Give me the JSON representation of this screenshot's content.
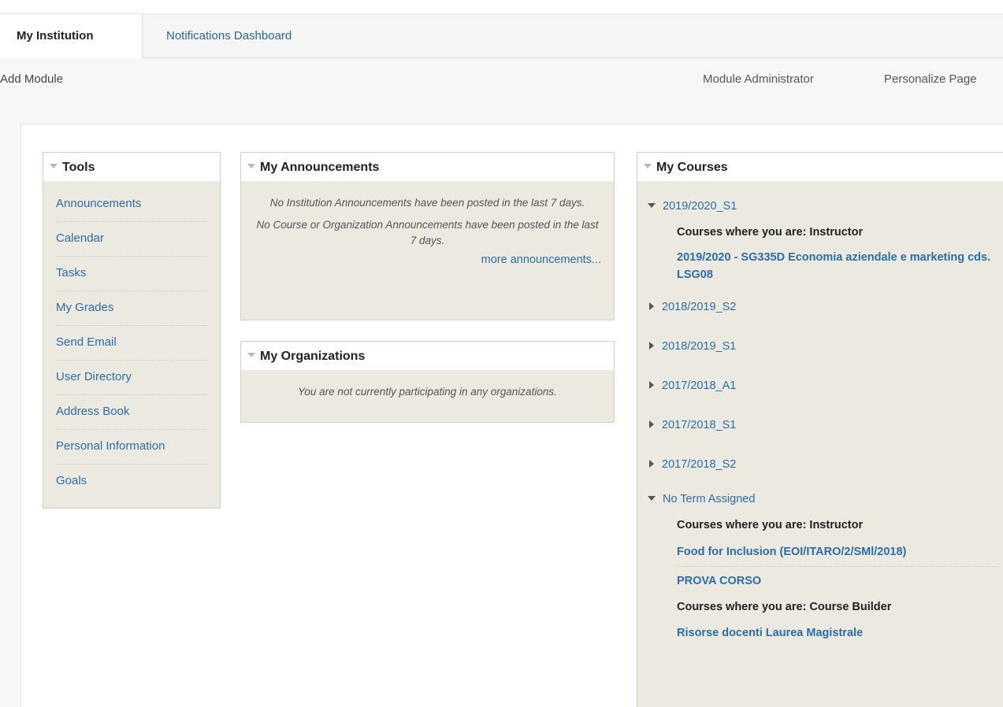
{
  "tabs": {
    "active": "My Institution",
    "other": "Notifications Dashboard"
  },
  "toolbar": {
    "add_module": "Add Module",
    "module_admin": "Module Administrator",
    "personalize": "Personalize Page"
  },
  "tools": {
    "title": "Tools",
    "items": [
      "Announcements",
      "Calendar",
      "Tasks",
      "My Grades",
      "Send Email",
      "User Directory",
      "Address Book",
      "Personal Information",
      "Goals"
    ]
  },
  "announcements": {
    "title": "My Announcements",
    "institution_msg": "No Institution Announcements have been posted in the last 7 days.",
    "course_msg": "No Course or Organization Announcements have been posted in the last 7 days.",
    "more_link": "more announcements..."
  },
  "organizations": {
    "title": "My Organizations",
    "empty_msg": "You are not currently participating in any organizations."
  },
  "courses": {
    "title": "My Courses",
    "term1": "2019/2020_S1",
    "term1_role": "Courses where you are: Instructor",
    "term1_course": "2019/2020 - SG335D Economia aziendale e marketing cds. LSG08",
    "collapsed_terms": [
      "2018/2019_S2",
      "2018/2019_S1",
      "2017/2018_A1",
      "2017/2018_S1",
      "2017/2018_S2"
    ],
    "noterm": "No Term Assigned",
    "noterm_role1": "Courses where you are: Instructor",
    "noterm_course1": "Food for Inclusion (EOI/ITARO/2/SMl/2018)",
    "noterm_course2": "PROVA CORSO",
    "noterm_role2": "Courses where you are: Course Builder",
    "noterm_course3": "Risorse docenti Laurea Magistrale"
  }
}
